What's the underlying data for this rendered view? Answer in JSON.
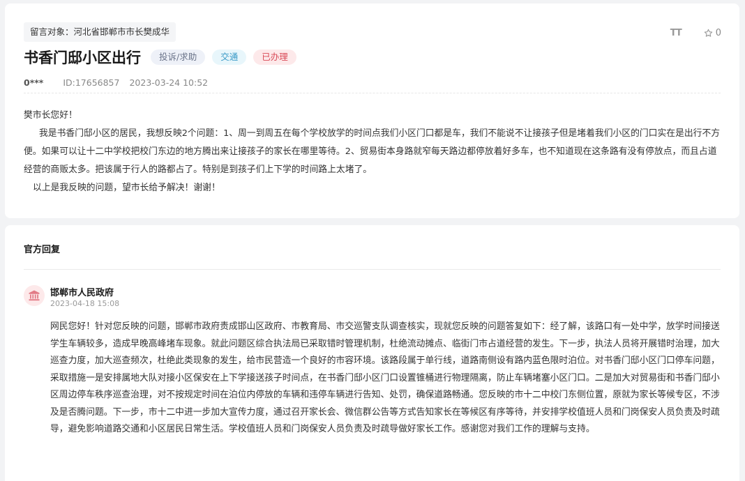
{
  "message": {
    "target": "留言对象：河北省邯郸市市长樊成华",
    "font_size_label": "TT",
    "favorite_count": "0",
    "title": "书香门邸小区出行",
    "tags": {
      "type": "投诉/求助",
      "topic": "交通",
      "status": "已办理"
    },
    "author": "0***",
    "id_text": "ID:17656857",
    "datetime": "2023-03-24 10:52",
    "greeting": "樊市长您好！",
    "paragraph": "我是书香门邸小区的居民，我想反映2个问题：1、周一到周五在每个学校放学的时间点我们小区门口都是车，我们不能说不让接孩子但是堵着我们小区的门口实在是出行不方便。如果可以让十二中学校把校门东边的地方腾出来让接孩子的家长在哪里等待。2、贸易街本身路就窄每天路边都停放着好多车，也不知道现在这条路有没有停放点，而且占道经营的商贩太多。把该属于行人的路都占了。特别是到孩子们上下学的时间路上太堵了。",
    "closing": "以上是我反映的问题，望市长给予解决！谢谢！"
  },
  "reply": {
    "section_title": "官方回复",
    "org_name": "邯郸市人民政府",
    "date": "2023-04-18 15:08",
    "body": "网民您好！针对您反映的问题，邯郸市政府责成邯山区政府、市教育局、市交巡警支队调查核实，现就您反映的问题答复如下：经了解，该路口有一处中学，放学时间接送学生车辆较多，造成早晚高峰堵车现象。就此问题区综合执法局已采取错时管理机制，杜绝流动摊点、临街门市占道经营的发生。下一步，执法人员将开展错时治理，加大巡查力度，加大巡查频次，杜绝此类现象的发生，给市民营造一个良好的市容环境。该路段属于单行线，道路南侧设有路内蓝色限时泊位。对书香门邸小区门口停车问题，采取措施一是安排属地大队对接小区保安在上下学接送孩子时间点，在书香门邸小区门口设置锥桶进行物理隔离，防止车辆堵塞小区门口。二是加大对贸易街和书香门邸小区周边停车秩序巡查治理，对不按规定时间在泊位内停放的车辆和违停车辆进行告知、处罚，确保道路畅通。您反映的市十二中校门东侧位置，原就为家长等候专区，不涉及是否腾问题。下一步，市十二中进一步加大宣传力度，通过召开家长会、微信群公告等方式告知家长在等候区有序等待，并安排学校值班人员和门岗保安人员负责及时疏导，避免影响道路交通和小区居民日常生活。学校值班人员和门岗保安人员负责及时疏导做好家长工作。感谢您对我们工作的理解与支持。"
  },
  "colors": {
    "page_bg": "#f2f3f5",
    "status_red": "#d94a57",
    "topic_blue": "#3a9ac7",
    "type_gray": "#6a7389"
  },
  "icons": {
    "font_size": "font-size-icon",
    "favorite": "star-icon",
    "org": "government-building-icon"
  }
}
